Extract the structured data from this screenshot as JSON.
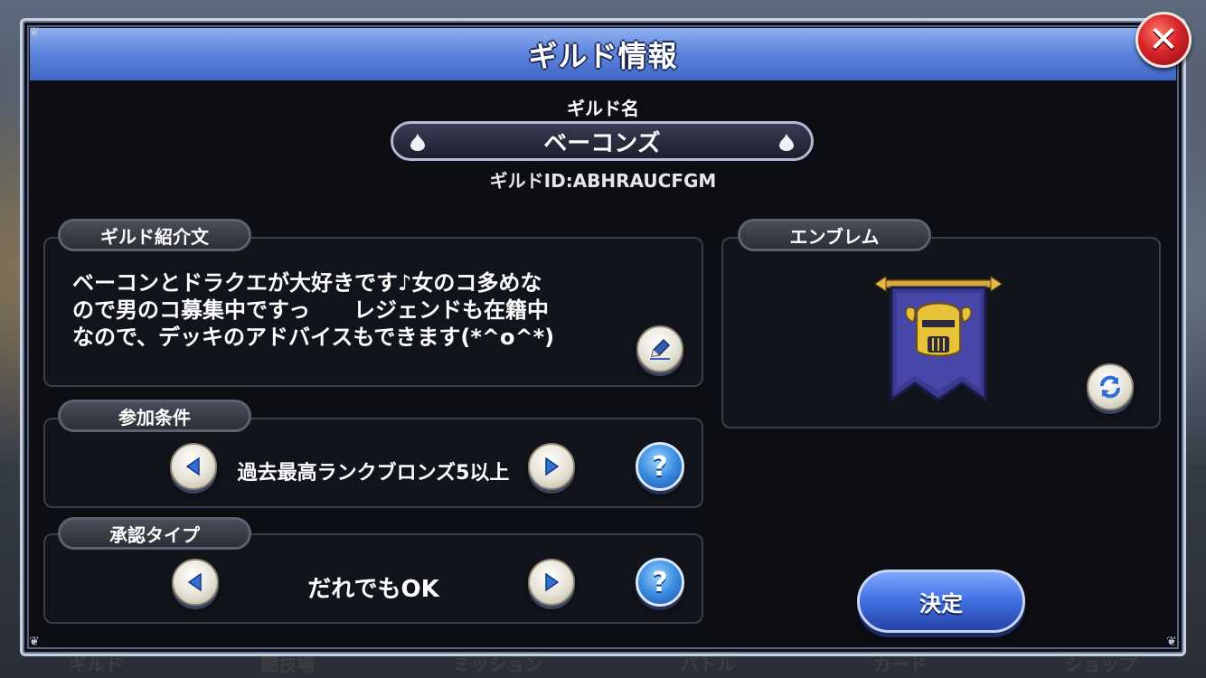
{
  "background": {
    "bottom_tabs": [
      "ギルド",
      "闘技場",
      "ミッション",
      "バトル",
      "カード",
      "ショップ"
    ]
  },
  "dialog": {
    "title": "ギルド情報",
    "close_label": "✕",
    "guild_name_label": "ギルド名",
    "guild_name": "ベーコンズ",
    "guild_id": "ギルドID:ABHRAUCFGM"
  },
  "intro": {
    "tag": "ギルド紹介文",
    "text": "ベーコンとドラクエが大好きです♪女のコ多めな\nので男のコ募集中ですっ　　レジェンドも在籍中\nなので、デッキのアドバイスもできます(*^o^*)"
  },
  "join_condition": {
    "tag": "参加条件",
    "value": "過去最高ランクブロンズ5以上",
    "help": "?"
  },
  "approval_type": {
    "tag": "承認タイプ",
    "value": "だれでもOK",
    "help": "?"
  },
  "emblem": {
    "tag": "エンブレム"
  },
  "decide_button": "決定",
  "colors": {
    "title_blue": "#5f86de",
    "close_red": "#d8242a",
    "decide_blue": "#3f6fe0",
    "panel_bg": "#12141b"
  }
}
